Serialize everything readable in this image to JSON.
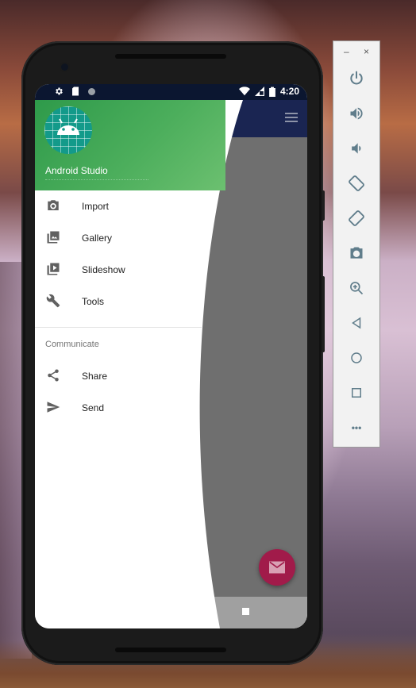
{
  "emulator_panel": {
    "minimize_label": "–",
    "close_label": "×",
    "tools": [
      {
        "name": "power-icon"
      },
      {
        "name": "volume-up-icon"
      },
      {
        "name": "volume-down-icon"
      },
      {
        "name": "rotate-left-icon"
      },
      {
        "name": "rotate-right-icon"
      },
      {
        "name": "camera-icon"
      },
      {
        "name": "zoom-icon"
      },
      {
        "name": "back-icon"
      },
      {
        "name": "home-icon"
      },
      {
        "name": "overview-icon"
      },
      {
        "name": "more-icon"
      }
    ],
    "more_label": "•••",
    "accent": "#607d8b"
  },
  "status_bar": {
    "time": "4:20"
  },
  "drawer": {
    "header_title": "Android Studio",
    "header_color": "#4cae5c",
    "items": [
      {
        "label": "Import",
        "icon": "camera-icon"
      },
      {
        "label": "Gallery",
        "icon": "gallery-icon"
      },
      {
        "label": "Slideshow",
        "icon": "slideshow-icon"
      },
      {
        "label": "Tools",
        "icon": "wrench-icon"
      }
    ],
    "section_label": "Communicate",
    "section_items": [
      {
        "label": "Share",
        "icon": "share-icon"
      },
      {
        "label": "Send",
        "icon": "send-icon"
      }
    ]
  },
  "app": {
    "toolbar_color": "#1a2552",
    "fab_color": "#a11b4a",
    "fab_icon": "mail-icon"
  }
}
